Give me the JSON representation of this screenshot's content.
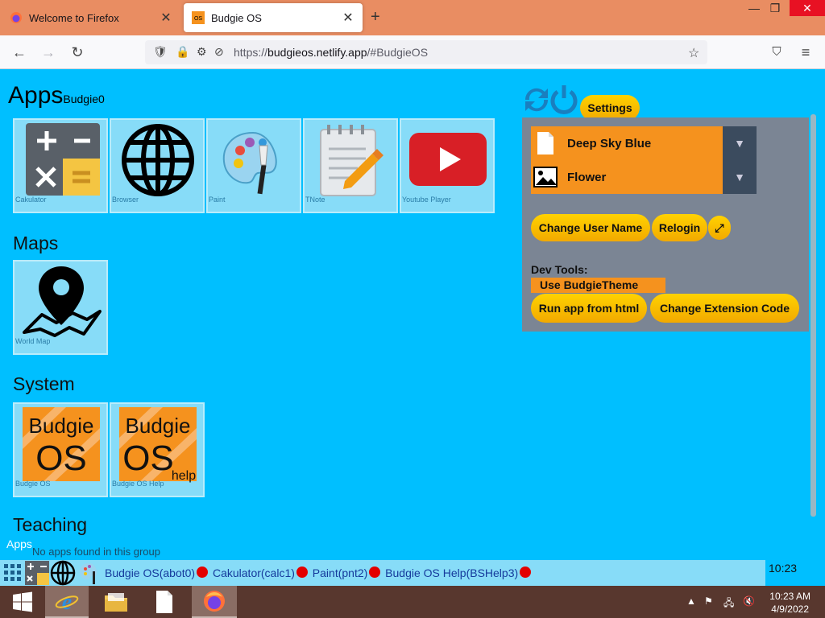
{
  "browser": {
    "tabs": [
      {
        "title": "Welcome to Firefox",
        "active": false
      },
      {
        "title": "Budgie OS",
        "active": true
      }
    ],
    "url_prefix": "https://",
    "url_host": "budgieos.netlify.app",
    "url_path": "/#BudgieOS"
  },
  "page": {
    "heading": "Apps",
    "heading_sub": "Budgie0",
    "sections": [
      {
        "title": "Maps"
      },
      {
        "title": "System"
      },
      {
        "title": "Teaching"
      }
    ],
    "apps": [
      {
        "label": "Cakulator",
        "icon": "calculator-icon"
      },
      {
        "label": "Browser",
        "icon": "globe-icon"
      },
      {
        "label": "Paint",
        "icon": "palette-icon"
      },
      {
        "label": "TNote",
        "icon": "notepad-icon"
      },
      {
        "label": "Youtube Player",
        "icon": "youtube-icon"
      }
    ],
    "maps": [
      {
        "label": "World Map",
        "icon": "map-pin-icon"
      }
    ],
    "system": [
      {
        "label": "Budgie OS",
        "icon": "budgie-os-logo",
        "logo_line1": "Budgie",
        "logo_line2": "OS"
      },
      {
        "label": "Budgie OS Help",
        "icon": "budgie-os-help-logo",
        "logo_line1": "Budgie",
        "logo_line2": "OS",
        "logo_suffix": "help"
      }
    ],
    "teaching_hint": "No apps found in this group"
  },
  "settings": {
    "button": "Settings",
    "theme_select": "Deep Sky Blue",
    "wallpaper_select": "Flower",
    "change_user": "Change User Name",
    "relogin": "Relogin",
    "dev_tools_label": "Dev Tools:",
    "use_theme": "Use BudgieTheme",
    "run_app": "Run app from html",
    "change_ext": "Change Extension Code"
  },
  "appbar": {
    "apps_label": "Apps",
    "running": [
      {
        "label": "Budgie OS(abot0)"
      },
      {
        "label": "Cakulator(calc1)"
      },
      {
        "label": "Paint(pnt2)"
      },
      {
        "label": "Budgie OS Help(BSHelp3)"
      }
    ],
    "clock": "10:23"
  },
  "windows_taskbar": {
    "time": "10:23 AM",
    "date": "4/9/2022"
  },
  "colors": {
    "page_bg": "#00bfff",
    "tile_bg": "#87dcf8",
    "panel_bg": "#7b8594",
    "accent_orange": "#f5921e",
    "pill_yellow": "#ffd200",
    "close_dot": "#e30000"
  }
}
